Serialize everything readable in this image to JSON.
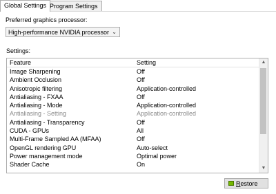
{
  "tabs": [
    {
      "label": "Global Settings"
    },
    {
      "label": "Program Settings"
    }
  ],
  "preferred_gpu": {
    "label": "Preferred graphics processor:",
    "value": "High-performance NVIDIA processor"
  },
  "settings": {
    "label": "Settings:",
    "columns": {
      "feature": "Feature",
      "setting": "Setting"
    },
    "rows": [
      {
        "feature": "Image Sharpening",
        "setting": "Off"
      },
      {
        "feature": "Ambient Occlusion",
        "setting": "Off"
      },
      {
        "feature": "Anisotropic filtering",
        "setting": "Application-controlled"
      },
      {
        "feature": "Antialiasing - FXAA",
        "setting": "Off"
      },
      {
        "feature": "Antialiasing - Mode",
        "setting": "Application-controlled"
      },
      {
        "feature": "Antialiasing - Setting",
        "setting": "Application-controlled"
      },
      {
        "feature": "Antialiasing - Transparency",
        "setting": "Off"
      },
      {
        "feature": "CUDA - GPUs",
        "setting": "All"
      },
      {
        "feature": "Multi-Frame Sampled AA (MFAA)",
        "setting": "Off"
      },
      {
        "feature": "OpenGL rendering GPU",
        "setting": "Auto-select"
      },
      {
        "feature": "Power management mode",
        "setting": "Optimal power"
      },
      {
        "feature": "Shader Cache",
        "setting": "On"
      }
    ]
  },
  "restore": {
    "label_first": "R",
    "label_rest": "estore"
  }
}
